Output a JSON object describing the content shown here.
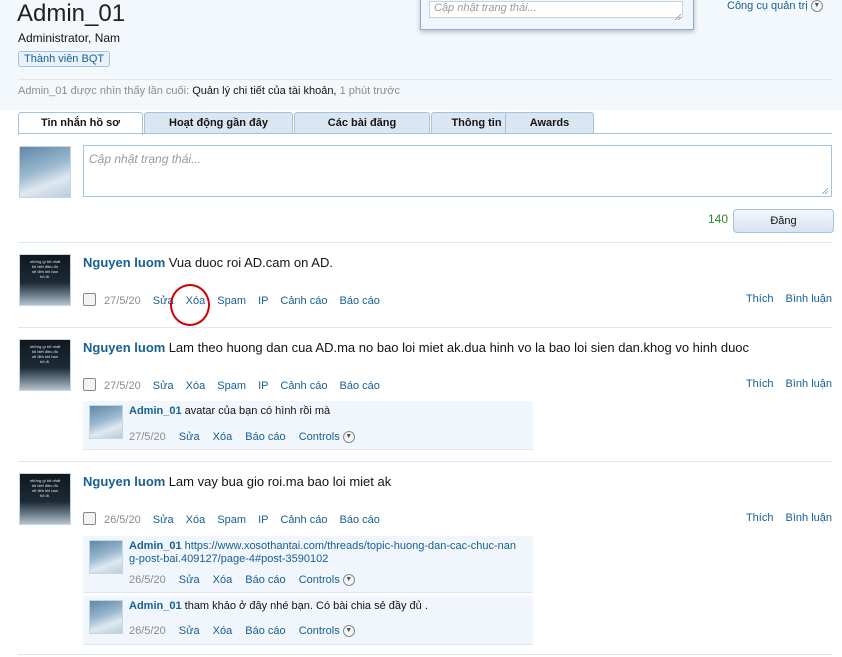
{
  "profile": {
    "username": "Admin_01",
    "title": "Administrator, Nam",
    "badge": "Thành viên BQT",
    "last_seen_prefix": "Admin_01 được nhìn thấy lần cuối:",
    "last_seen_activity": "Quản lý chi tiết của tài khoản,",
    "last_seen_time": "1 phút trước"
  },
  "header": {
    "popup_status_placeholder": "Cập nhật trạng thái...",
    "tools_menu": "Công cụ quản trị"
  },
  "tabs": [
    "Tin nhắn hồ sơ",
    "Hoạt động gần đây",
    "Các bài đăng",
    "Thông tin",
    "Awards"
  ],
  "composer": {
    "placeholder": "Cập nhật trạng thái...",
    "counter": "140",
    "post_label": "Đăng"
  },
  "action_labels": {
    "edit": "Sửa",
    "delete": "Xóa",
    "spam": "Spam",
    "ip": "IP",
    "warn": "Cảnh cáo",
    "report": "Báo cáo",
    "like": "Thích",
    "comment": "Bình luận",
    "controls": "Controls"
  },
  "messages": [
    {
      "author": "Nguyen luom",
      "text": "Vua duoc roi AD.cam on AD.",
      "date": "27/5/20"
    },
    {
      "author": "Nguyen luom",
      "text": "Lam theo huong dan cua AD.ma no bao loi miet ak.dua hinh vo la bao loi sien dan.khog vo hinh duoc",
      "date": "27/5/20"
    },
    {
      "author": "Nguyen luom",
      "text": "Lam vay bua gio roi.ma bao loi miet ak",
      "date": "26/5/20"
    }
  ],
  "comments": [
    {
      "author": "Admin_01",
      "text": "avatar của bạn có hình rồi mà",
      "date": "27/5/20"
    },
    {
      "author": "Admin_01",
      "text": "https://www.xosothantai.com/threads/topic-huong-dan-cac-chuc-nang-post-bai.409127/page-4#post-3590102",
      "date": "26/5/20"
    },
    {
      "author": "Admin_01",
      "text": "tham khảo ở đây nhé bạn. Có bài chia sẻ đầy đủ .",
      "date": "26/5/20"
    }
  ],
  "avatar_text_lines": [
    "những gì tốt nhất",
    "tôi biết điều đó",
    "sẽ đến khi bạn",
    "bỏ đi."
  ]
}
